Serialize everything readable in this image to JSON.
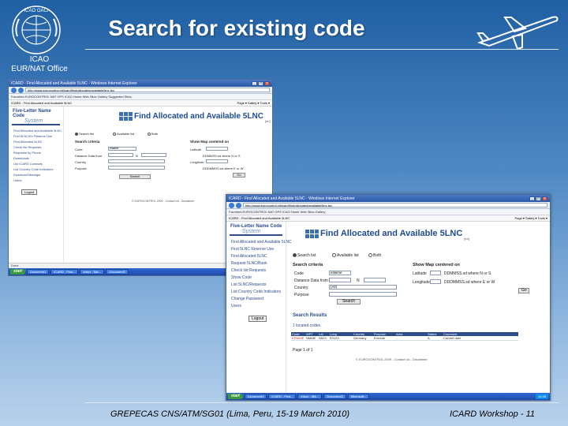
{
  "slide": {
    "title": "Search for existing code",
    "logo_caption_line1": "ICAO",
    "logo_caption_line2": "EUR/NAT Office",
    "footer_left": "GREPECAS CNS/ATM/SG01 (Lima, Peru, 15-19 March 2010)",
    "footer_right": "ICARD Workshop - 11"
  },
  "window1": {
    "title": "ICARD - Find Allocated and Available 5LNC - Windows Internet Explorer",
    "address": "http://www.eurocontrol.int/icard/find/allocated/available5lnc.jsp",
    "favorites": "Favorites   EUROCONTROL   NAT OPS   ICAO Home   Web Slice Gallery   Suggested Sites",
    "tab": "ICARD - Find Allocated and Available 5LNC",
    "tab_right": "Page ▾  Safety ▾  Tools ▾",
    "sidebar": {
      "logo1": "Five-Letter Name Code",
      "logo2": "System",
      "items": [
        "Find Allocated and Available 5LNC",
        "Find 5LNC/Ex Reserve Use",
        "Find Allocated 5LNC",
        "Check list Requests",
        "Requests by Phone",
        "Downloads",
        "List ICARD Contacts",
        "List Country Code Indicators",
        "Download Manager",
        "Users"
      ],
      "logout": "Logout"
    },
    "banner": "Find Allocated and Available 5LNC",
    "banner_ver": "[en]",
    "radios": [
      "Search list",
      "Available list",
      "Both"
    ],
    "search_criteria": "Search criteria",
    "code_label": "Code",
    "code_value": "edwme",
    "distance_label": "Distance Data from",
    "country_label": "Country",
    "purpose_label": "Purpose",
    "distance_unit": "N",
    "search_button": "Search",
    "map_label": "Show Map centered on",
    "latitude_label": "Latitude",
    "longitude_label": "Longitude",
    "lat_hint": "DDMMSS.sd  where N or S",
    "lon_hint": "DDDMMSS.sd  where E or W",
    "go_button": "Go",
    "copyright": "© EUROCONTROL 2009 - Contact Us - Disclaimer",
    "status": "Done",
    "status_right": "Internet  100%",
    "taskbar": [
      "Document1",
      "ICARD - Find...",
      "Inbox - Mic...",
      "Document2"
    ],
    "clock": "10:44"
  },
  "window2": {
    "title": "ICARD - Find Allocated and Available 5LNC - Windows Internet Explorer",
    "address": "http://www.eurocontrol.int/icard/find/allocated/available5lnc.jsp",
    "favorites": "Favorites   EUROCONTROL   NAT OPS   ICAO Home   Web Slice Gallery",
    "tab": "ICARD - Find Allocated and Available 5LNC",
    "tab_right": "Page ▾  Safety ▾  Tools ▾",
    "sidebar": {
      "logo1": "Five-Letter Name Code",
      "logo2": "System",
      "items": [
        "Find Allocated and Available 5LNC",
        "Find 5LNC Reserve Use",
        "Find Allocated 5LNC",
        "Request 5LNC/Book",
        "Check list Requests",
        "Show Code",
        "List 5LNC/Requests",
        "List Country Code Indicators",
        "Change Password",
        "Users"
      ],
      "logout": "Logout"
    },
    "banner": "Find Allocated and Available 5LNC",
    "banner_ver": "[en]",
    "radios": [
      "Search list",
      "Available list",
      "Both"
    ],
    "search_criteria": "Search criteria",
    "code_label": "Code",
    "code_value": "edwme",
    "distance_label": "Distance Data from",
    "country_label": "Country",
    "country_value": "(All)",
    "purpose_label": "Purpose",
    "distance_unit": "N",
    "search_button": "Search",
    "map_label": "Show Map centered on",
    "latitude_label": "Latitude",
    "longitude_label": "Longitude",
    "lat_hint": "DDMMSS.sd  where N or S",
    "lon_hint": "DDDMMSS.sd  where E or W",
    "go_button": "Go",
    "results_title": "Search Results",
    "results_count": "1 located codes",
    "results_columns": [
      "Code",
      "WPT",
      "Lat",
      "Long",
      "Country",
      "Purpose",
      "Area",
      "Status",
      "Comment"
    ],
    "results_row": [
      "EDWME",
      "NMME",
      "N523",
      "E0123",
      "Germany",
      "Enroute",
      "-",
      "A",
      "Current user"
    ],
    "page_info": "Page 1 of 1",
    "copyright": "© EUROCONTROL 2009 - Contact Us - Disclaimer",
    "status": "Done",
    "status_right": "Internet  100%",
    "taskbar": [
      "Document1",
      "ICARD - Find...",
      "Inbox - Mic...",
      "Document2",
      "Microsoft..."
    ],
    "clock": "10:45"
  }
}
